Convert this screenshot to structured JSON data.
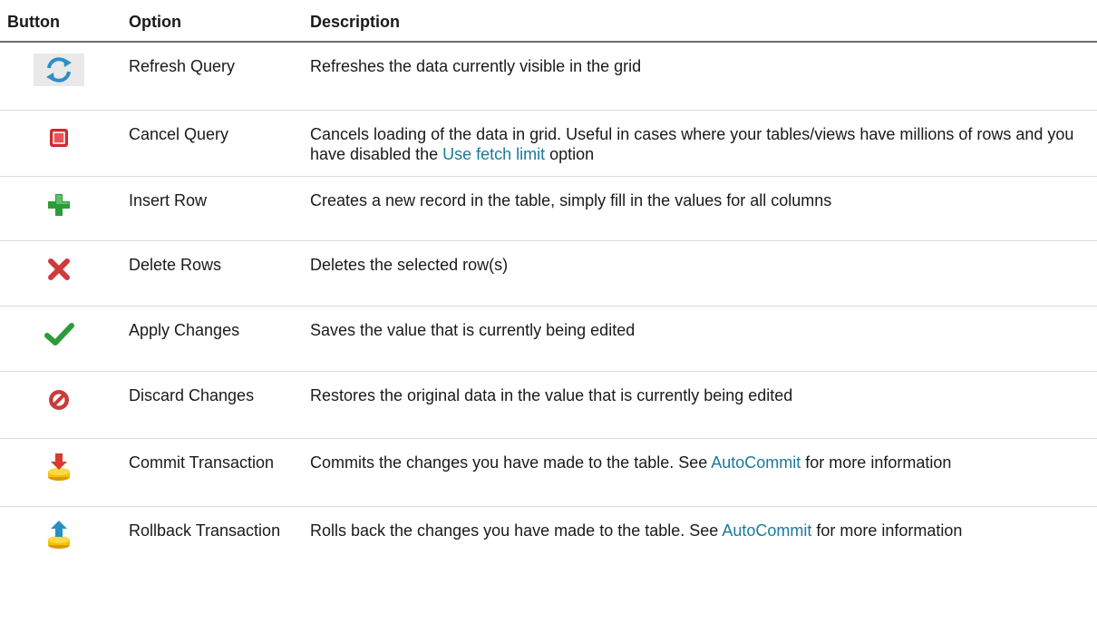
{
  "headers": {
    "button": "Button",
    "option": "Option",
    "description": "Description"
  },
  "rows": [
    {
      "icon": "refresh-icon",
      "option": "Refresh Query",
      "desc_before": "Refreshes the data currently visible in the grid",
      "link": "",
      "desc_after": ""
    },
    {
      "icon": "stop-icon",
      "option": "Cancel Query",
      "desc_before": "Cancels loading of the data in grid. Useful in cases where your tables/views have millions of rows and you have disabled the ",
      "link": "Use fetch limit",
      "desc_after": " option"
    },
    {
      "icon": "plus-icon",
      "option": "Insert Row",
      "desc_before": "Creates a new record in the table, simply fill in the values for all columns",
      "link": "",
      "desc_after": ""
    },
    {
      "icon": "delete-icon",
      "option": "Delete Rows",
      "desc_before": "Deletes the selected row(s)",
      "link": "",
      "desc_after": ""
    },
    {
      "icon": "checkmark-icon",
      "option": "Apply Changes",
      "desc_before": "Saves the value that is currently being edited",
      "link": "",
      "desc_after": ""
    },
    {
      "icon": "discard-icon",
      "option": "Discard Changes",
      "desc_before": "Restores the original data in the value that is currently being edited",
      "link": "",
      "desc_after": ""
    },
    {
      "icon": "commit-icon",
      "option": "Commit Transaction",
      "desc_before": "Commits the changes you have made to the table. See ",
      "link": "AutoCommit",
      "desc_after": " for more information"
    },
    {
      "icon": "rollback-icon",
      "option": "Rollback Transaction",
      "desc_before": "Rolls back the changes you have made to the table. See ",
      "link": "AutoCommit",
      "desc_after": " for more information"
    }
  ],
  "colors": {
    "link": "#1a7a99",
    "header_rule": "#6e6e6e",
    "row_rule": "#d9d9d9"
  }
}
